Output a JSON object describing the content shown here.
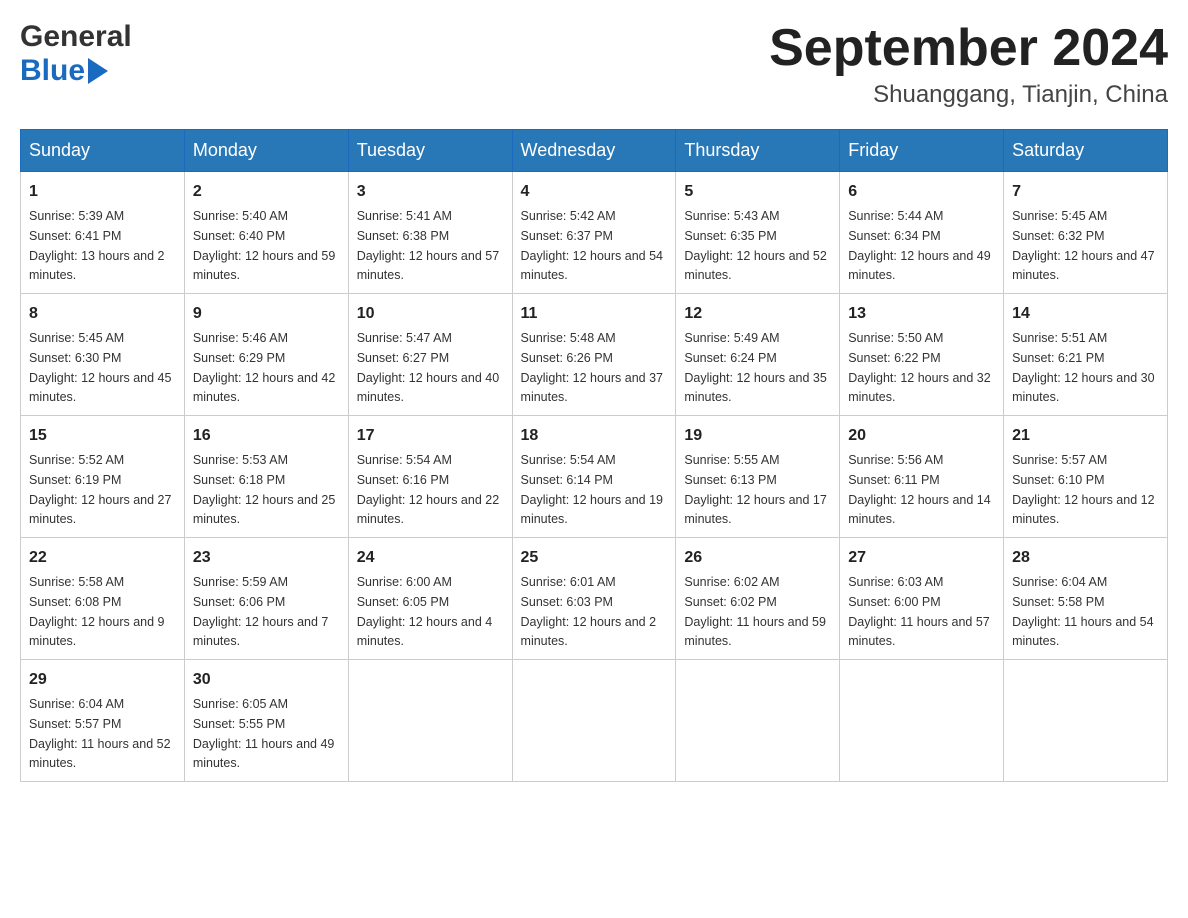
{
  "header": {
    "logo_general": "General",
    "logo_blue": "Blue",
    "month_title": "September 2024",
    "location": "Shuanggang, Tianjin, China"
  },
  "weekdays": [
    "Sunday",
    "Monday",
    "Tuesday",
    "Wednesday",
    "Thursday",
    "Friday",
    "Saturday"
  ],
  "weeks": [
    [
      {
        "day": "1",
        "sunrise": "5:39 AM",
        "sunset": "6:41 PM",
        "daylight": "13 hours and 2 minutes."
      },
      {
        "day": "2",
        "sunrise": "5:40 AM",
        "sunset": "6:40 PM",
        "daylight": "12 hours and 59 minutes."
      },
      {
        "day": "3",
        "sunrise": "5:41 AM",
        "sunset": "6:38 PM",
        "daylight": "12 hours and 57 minutes."
      },
      {
        "day": "4",
        "sunrise": "5:42 AM",
        "sunset": "6:37 PM",
        "daylight": "12 hours and 54 minutes."
      },
      {
        "day": "5",
        "sunrise": "5:43 AM",
        "sunset": "6:35 PM",
        "daylight": "12 hours and 52 minutes."
      },
      {
        "day": "6",
        "sunrise": "5:44 AM",
        "sunset": "6:34 PM",
        "daylight": "12 hours and 49 minutes."
      },
      {
        "day": "7",
        "sunrise": "5:45 AM",
        "sunset": "6:32 PM",
        "daylight": "12 hours and 47 minutes."
      }
    ],
    [
      {
        "day": "8",
        "sunrise": "5:45 AM",
        "sunset": "6:30 PM",
        "daylight": "12 hours and 45 minutes."
      },
      {
        "day": "9",
        "sunrise": "5:46 AM",
        "sunset": "6:29 PM",
        "daylight": "12 hours and 42 minutes."
      },
      {
        "day": "10",
        "sunrise": "5:47 AM",
        "sunset": "6:27 PM",
        "daylight": "12 hours and 40 minutes."
      },
      {
        "day": "11",
        "sunrise": "5:48 AM",
        "sunset": "6:26 PM",
        "daylight": "12 hours and 37 minutes."
      },
      {
        "day": "12",
        "sunrise": "5:49 AM",
        "sunset": "6:24 PM",
        "daylight": "12 hours and 35 minutes."
      },
      {
        "day": "13",
        "sunrise": "5:50 AM",
        "sunset": "6:22 PM",
        "daylight": "12 hours and 32 minutes."
      },
      {
        "day": "14",
        "sunrise": "5:51 AM",
        "sunset": "6:21 PM",
        "daylight": "12 hours and 30 minutes."
      }
    ],
    [
      {
        "day": "15",
        "sunrise": "5:52 AM",
        "sunset": "6:19 PM",
        "daylight": "12 hours and 27 minutes."
      },
      {
        "day": "16",
        "sunrise": "5:53 AM",
        "sunset": "6:18 PM",
        "daylight": "12 hours and 25 minutes."
      },
      {
        "day": "17",
        "sunrise": "5:54 AM",
        "sunset": "6:16 PM",
        "daylight": "12 hours and 22 minutes."
      },
      {
        "day": "18",
        "sunrise": "5:54 AM",
        "sunset": "6:14 PM",
        "daylight": "12 hours and 19 minutes."
      },
      {
        "day": "19",
        "sunrise": "5:55 AM",
        "sunset": "6:13 PM",
        "daylight": "12 hours and 17 minutes."
      },
      {
        "day": "20",
        "sunrise": "5:56 AM",
        "sunset": "6:11 PM",
        "daylight": "12 hours and 14 minutes."
      },
      {
        "day": "21",
        "sunrise": "5:57 AM",
        "sunset": "6:10 PM",
        "daylight": "12 hours and 12 minutes."
      }
    ],
    [
      {
        "day": "22",
        "sunrise": "5:58 AM",
        "sunset": "6:08 PM",
        "daylight": "12 hours and 9 minutes."
      },
      {
        "day": "23",
        "sunrise": "5:59 AM",
        "sunset": "6:06 PM",
        "daylight": "12 hours and 7 minutes."
      },
      {
        "day": "24",
        "sunrise": "6:00 AM",
        "sunset": "6:05 PM",
        "daylight": "12 hours and 4 minutes."
      },
      {
        "day": "25",
        "sunrise": "6:01 AM",
        "sunset": "6:03 PM",
        "daylight": "12 hours and 2 minutes."
      },
      {
        "day": "26",
        "sunrise": "6:02 AM",
        "sunset": "6:02 PM",
        "daylight": "11 hours and 59 minutes."
      },
      {
        "day": "27",
        "sunrise": "6:03 AM",
        "sunset": "6:00 PM",
        "daylight": "11 hours and 57 minutes."
      },
      {
        "day": "28",
        "sunrise": "6:04 AM",
        "sunset": "5:58 PM",
        "daylight": "11 hours and 54 minutes."
      }
    ],
    [
      {
        "day": "29",
        "sunrise": "6:04 AM",
        "sunset": "5:57 PM",
        "daylight": "11 hours and 52 minutes."
      },
      {
        "day": "30",
        "sunrise": "6:05 AM",
        "sunset": "5:55 PM",
        "daylight": "11 hours and 49 minutes."
      },
      null,
      null,
      null,
      null,
      null
    ]
  ],
  "labels": {
    "sunrise": "Sunrise:",
    "sunset": "Sunset:",
    "daylight": "Daylight:"
  }
}
